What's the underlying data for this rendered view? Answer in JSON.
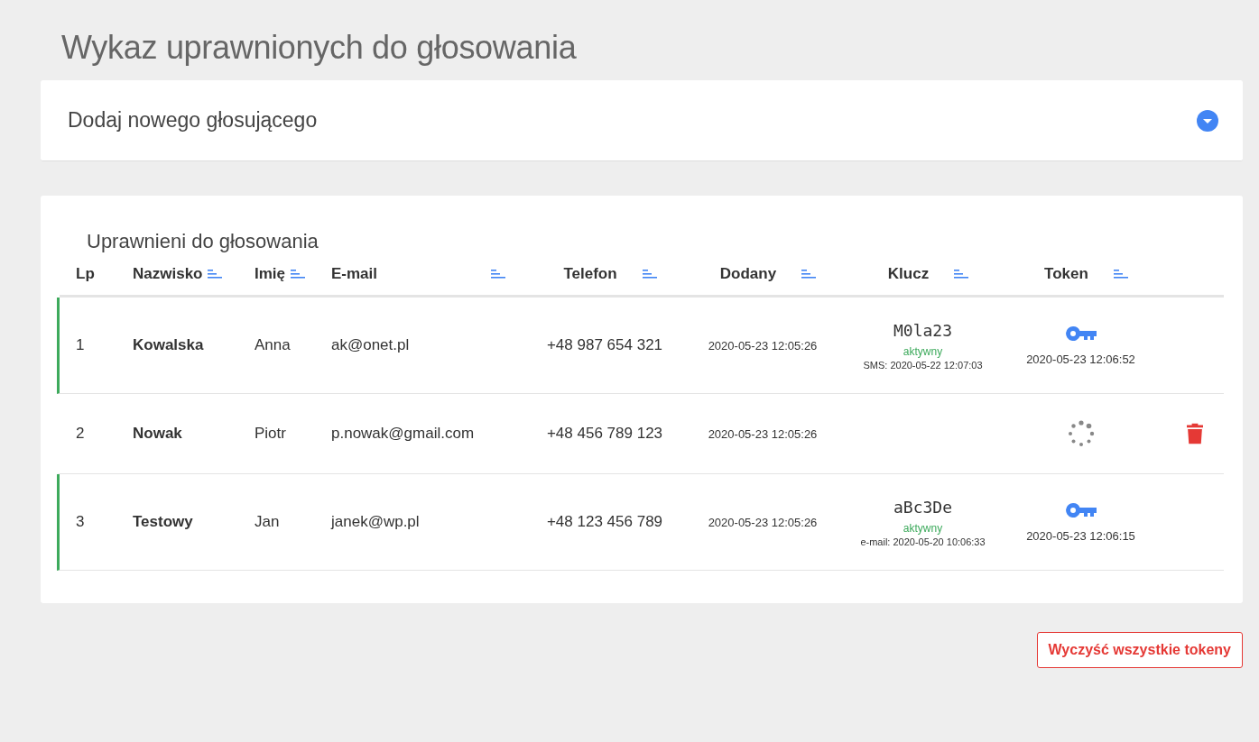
{
  "page_title": "Wykaz uprawnionych do głosowania",
  "add_panel": {
    "title": "Dodaj nowego głosującego",
    "expanded": false
  },
  "list": {
    "title": "Uprawnieni do głosowania",
    "columns": [
      {
        "label": "Lp",
        "sortable": false
      },
      {
        "label": "Nazwisko",
        "sortable": true
      },
      {
        "label": "Imię",
        "sortable": true
      },
      {
        "label": "E-mail",
        "sortable": true
      },
      {
        "label": "Telefon",
        "sortable": true
      },
      {
        "label": "Dodany",
        "sortable": true
      },
      {
        "label": "Klucz",
        "sortable": true
      },
      {
        "label": "Token",
        "sortable": true
      }
    ],
    "rows": [
      {
        "lp": "1",
        "surname": "Kowalska",
        "name": "Anna",
        "email": "ak@onet.pl",
        "phone": "+48 987 654 321",
        "added": "2020-05-23 12:05:26",
        "active": true,
        "key": {
          "code": "M0la23",
          "status": "aktywny",
          "sent": "SMS: 2020-05-22 12:07:03"
        },
        "token": {
          "kind": "key",
          "time": "2020-05-23 12:06:52"
        },
        "deletable": false
      },
      {
        "lp": "2",
        "surname": "Nowak",
        "name": "Piotr",
        "email": "p.nowak@gmail.com",
        "phone": "+48 456 789 123",
        "added": "2020-05-23 12:05:26",
        "active": false,
        "token": {
          "kind": "pending"
        },
        "deletable": true
      },
      {
        "lp": "3",
        "surname": "Testowy",
        "name": "Jan",
        "email": "janek@wp.pl",
        "phone": "+48 123 456 789",
        "added": "2020-05-23 12:05:26",
        "active": true,
        "key": {
          "code": "aBc3De",
          "status": "aktywny",
          "sent": "e-mail: 2020-05-20 10:06:33"
        },
        "token": {
          "kind": "key",
          "time": "2020-05-23 12:06:15"
        },
        "deletable": false
      }
    ]
  },
  "clear_button": "Wyczyść wszystkie tokeny"
}
